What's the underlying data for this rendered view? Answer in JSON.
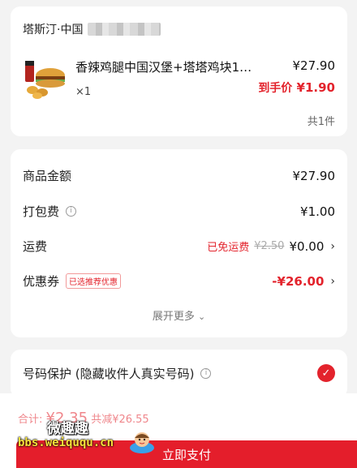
{
  "order": {
    "shop_name": "塔斯汀·中国",
    "product_name": "香辣鸡腿中国汉堡+塔塔鸡块1…",
    "quantity": "×1",
    "price": "¥27.90",
    "final_price_label": "到手价",
    "final_price": "¥1.90",
    "total_count": "共1件"
  },
  "price_detail": {
    "goods_amount_label": "商品金额",
    "goods_amount": "¥27.90",
    "packing_fee_label": "打包费",
    "packing_fee": "¥1.00",
    "shipping_label": "运费",
    "shipping_waived": "已免运费",
    "shipping_original": "¥2.50",
    "shipping_fee": "¥0.00",
    "coupon_label": "优惠券",
    "coupon_tag": "已选推荐优惠",
    "coupon_value": "-¥26.00",
    "expand_more": "展开更多"
  },
  "privacy": {
    "label": "号码保护 (隐藏收件人真实号码)",
    "checked": true
  },
  "footer": {
    "total_label": "合计:",
    "total_value": "¥2.35",
    "saved": "共减¥26.55",
    "pay_button": "立即支付"
  },
  "watermark": {
    "line1": "微趣趣",
    "line2": "bbs.weiququ.cn"
  },
  "colors": {
    "accent": "#e3232c",
    "background": "#f3f3f3"
  },
  "icons": [
    "info-icon",
    "chevron-right-icon",
    "chevron-down-icon",
    "check-icon",
    "burger-thumbnail"
  ]
}
